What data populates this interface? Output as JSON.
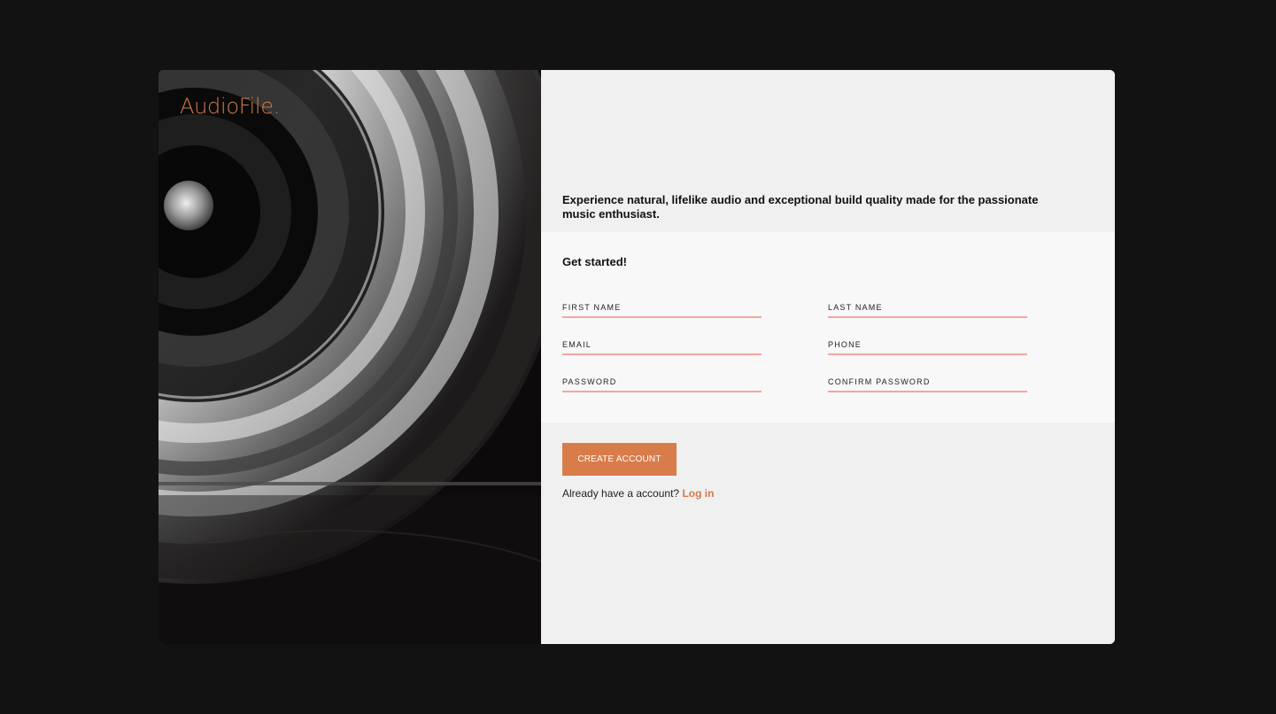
{
  "brand": {
    "logo": "AudioFile."
  },
  "intro": {
    "text": "Experience natural, lifelike audio and exceptional build quality made for the passionate music enthusiast."
  },
  "form": {
    "heading": "Get started!",
    "fields": {
      "first_name": "FIRST NAME",
      "last_name": "LAST NAME",
      "email": "EMAIL",
      "phone": "PHONE",
      "password": "PASSWORD",
      "confirm_password": "CONFIRM PASSWORD"
    },
    "submit_label": "CREATE ACCOUNT"
  },
  "login": {
    "prompt": "Already have a account?",
    "link_label": "Log in"
  },
  "colors": {
    "accent": "#d87c4a",
    "field_underline": "#f4a6a0",
    "page_background": "#121212",
    "panel_background": "#f0f0f0"
  }
}
